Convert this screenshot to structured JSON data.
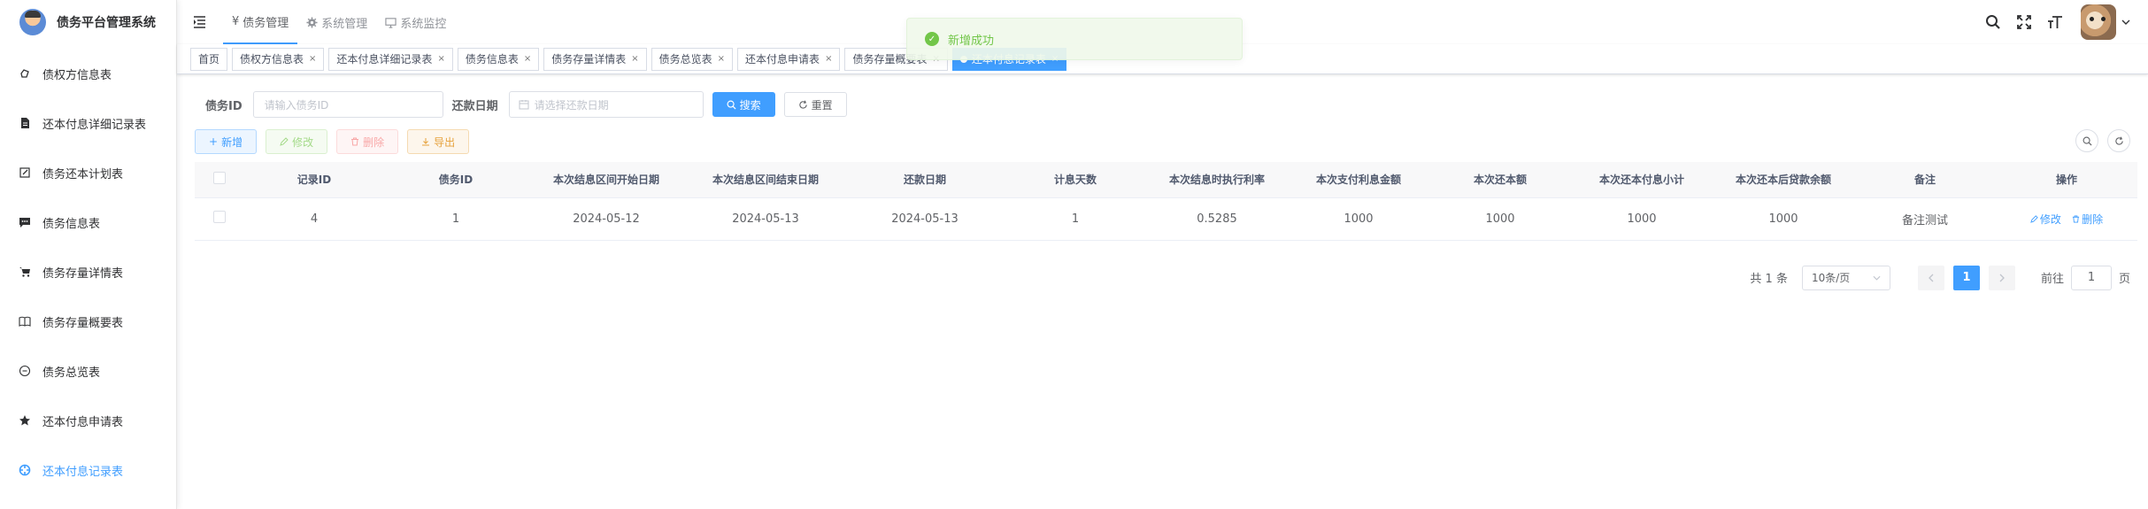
{
  "app": {
    "title": "债务平台管理系统"
  },
  "sidebar": {
    "items": [
      {
        "label": "债权方信息表",
        "icon": "hand-icon"
      },
      {
        "label": "还本付息详细记录表",
        "icon": "document-icon"
      },
      {
        "label": "债务还本计划表",
        "icon": "edit-icon"
      },
      {
        "label": "债务信息表",
        "icon": "message-icon"
      },
      {
        "label": "债务存量详情表",
        "icon": "cart-icon"
      },
      {
        "label": "债务存量概要表",
        "icon": "book-icon"
      },
      {
        "label": "债务总览表",
        "icon": "minus-circle-icon"
      },
      {
        "label": "还本付息申请表",
        "icon": "star-icon"
      },
      {
        "label": "还本付息记录表",
        "icon": "target-icon"
      }
    ]
  },
  "top_menu": [
    {
      "label": "债务管理",
      "icon": "yen-icon"
    },
    {
      "label": "系统管理",
      "icon": "gear-icon"
    },
    {
      "label": "系统监控",
      "icon": "monitor-icon"
    }
  ],
  "tags": [
    {
      "label": "首页"
    },
    {
      "label": "债权方信息表"
    },
    {
      "label": "还本付息详细记录表"
    },
    {
      "label": "债务信息表"
    },
    {
      "label": "债务存量详情表"
    },
    {
      "label": "债务总览表"
    },
    {
      "label": "还本付息申请表"
    },
    {
      "label": "债务存量概要表"
    },
    {
      "label": "还本付息记录表"
    }
  ],
  "search": {
    "debt_id_label": "债务ID",
    "debt_id_placeholder": "请输入债务ID",
    "date_label": "还款日期",
    "date_placeholder": "请选择还款日期",
    "search_btn": "搜索",
    "reset_btn": "重置"
  },
  "toolbar": {
    "add": "新增",
    "edit": "修改",
    "delete": "删除",
    "export": "导出"
  },
  "table": {
    "headers": [
      "记录ID",
      "债务ID",
      "本次结息区间开始日期",
      "本次结息区间结束日期",
      "还款日期",
      "计息天数",
      "本次结息时执行利率",
      "本次支付利息金额",
      "本次还本额",
      "本次还本付息小计",
      "本次还本后贷款余额",
      "备注",
      "操作"
    ],
    "rows": [
      [
        "4",
        "1",
        "2024-05-12",
        "2024-05-13",
        "2024-05-13",
        "1",
        "0.5285",
        "1000",
        "1000",
        "1000",
        "1000",
        "备注测试"
      ]
    ],
    "row_edit": "修改",
    "row_delete": "删除"
  },
  "pagination": {
    "total": "共 1 条",
    "page_size": "10条/页",
    "current": "1",
    "goto_prefix": "前往",
    "goto_value": "1",
    "goto_suffix": "页"
  },
  "toast": {
    "message": "新增成功"
  },
  "colors": {
    "primary": "#409eff",
    "success": "#67c23a",
    "danger": "#f56c6c",
    "warning": "#e6a23c"
  }
}
